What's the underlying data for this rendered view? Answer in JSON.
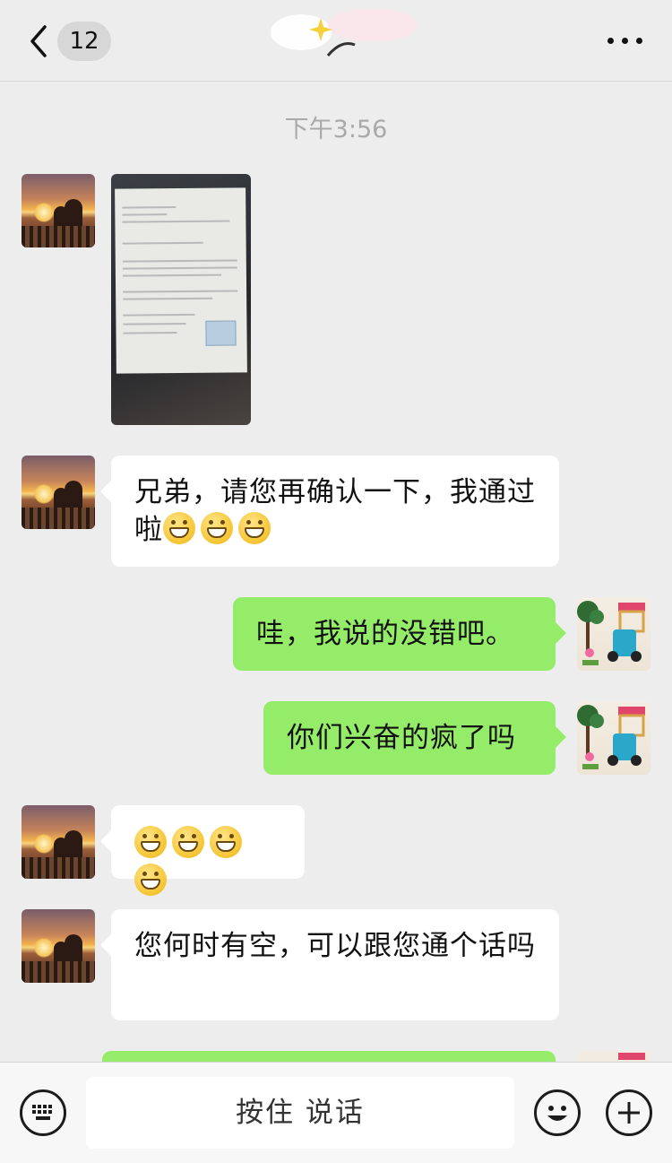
{
  "header": {
    "back_icon": "chevron-left-icon",
    "unread_count": "12",
    "more_icon": "more-dots-icon"
  },
  "chat": {
    "timestamp": "下午3:56",
    "messages": [
      {
        "side": "left",
        "type": "image",
        "avatar": "sunset-couple-avatar"
      },
      {
        "side": "left",
        "type": "text",
        "text": "兄弟，请您再确认一下，我通过啦",
        "emoji": [
          "grin-emoji",
          "grin-emoji",
          "grin-emoji"
        ]
      },
      {
        "side": "right",
        "type": "text",
        "text": "哇，我说的没错吧。",
        "avatar": "lego-avatar"
      },
      {
        "side": "right",
        "type": "text",
        "text": "你们兴奋的疯了吗",
        "avatar": "lego-avatar"
      },
      {
        "side": "left",
        "type": "emoji",
        "emoji": [
          "grin-emoji",
          "grin-emoji",
          "grin-emoji",
          "grin-emoji"
        ]
      },
      {
        "side": "left",
        "type": "text",
        "text": "您何时有空，可以跟您通个话吗"
      },
      {
        "side": "right",
        "type": "text",
        "text": ""
      }
    ]
  },
  "bottom": {
    "voice_keyboard_icon": "keyboard-icon",
    "hold_to_talk": "按住 说话",
    "emoji_icon": "smiley-icon",
    "plus_icon": "plus-icon"
  },
  "colors": {
    "background": "#ededed",
    "bubble_self": "#95ec69",
    "bubble_other": "#ffffff"
  }
}
